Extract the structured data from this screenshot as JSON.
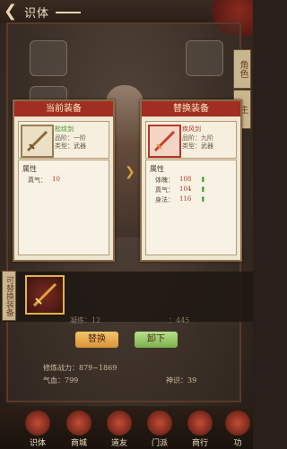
{
  "header": {
    "title": "识体"
  },
  "side_tabs": {
    "role": "角色",
    "secondary": "主"
  },
  "left_panel": {
    "heading": "当前装备",
    "item": {
      "name": "松纹剑",
      "quality": "品阶：一阶",
      "type": "类型：武器"
    },
    "attributes_title": "属性",
    "attributes": [
      {
        "name": "真气：",
        "value": "10"
      }
    ]
  },
  "right_panel": {
    "heading": "替换装备",
    "item": {
      "name": "疾风剑",
      "quality": "品阶：九阶",
      "type": "类型：武器"
    },
    "attributes_title": "属性",
    "attributes": [
      {
        "name": "体魄：",
        "value": "108"
      },
      {
        "name": "真气：",
        "value": "104"
      },
      {
        "name": "身法：",
        "value": "116"
      }
    ]
  },
  "bag": {
    "tab_label": "可替换装备"
  },
  "info": {
    "partial_left": "凝练：12",
    "partial_right": "：445",
    "damage": "修炼战力：879~1869",
    "hp": "气血：799",
    "lifespan": "神识：39"
  },
  "buttons": {
    "replace": "替换",
    "unequip": "卸下"
  },
  "nav": [
    {
      "label": "识体"
    },
    {
      "label": "商城"
    },
    {
      "label": "道友"
    },
    {
      "label": "门派"
    },
    {
      "label": "商行"
    },
    {
      "label": "功"
    }
  ]
}
